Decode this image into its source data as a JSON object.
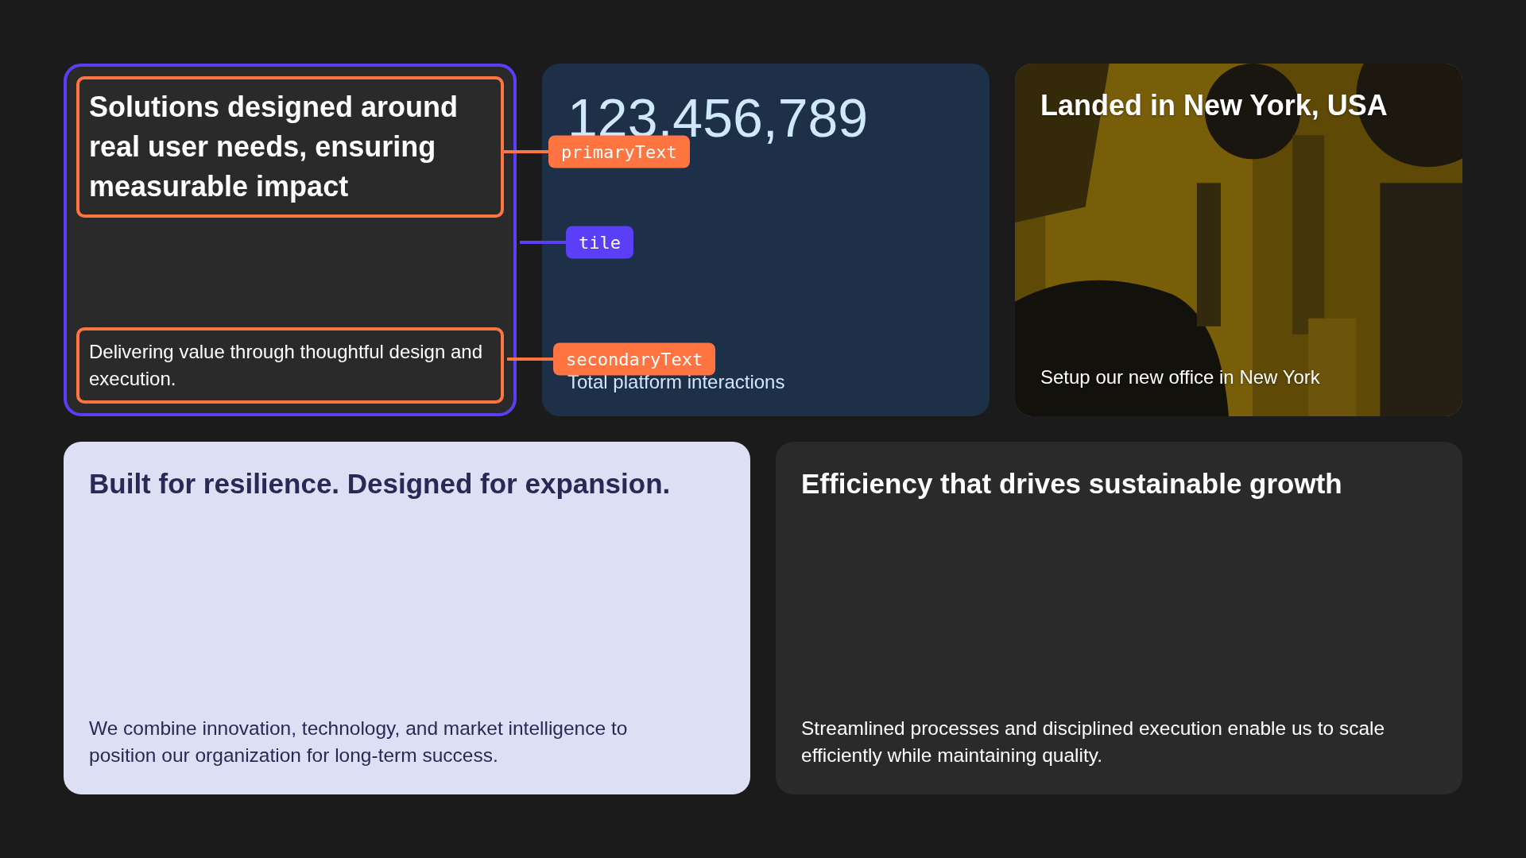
{
  "tiles": [
    {
      "kind": "text",
      "primary": "Solutions designed around real user needs, ensuring measurable impact",
      "secondary": "Delivering value through thoughtful design and execution."
    },
    {
      "kind": "stat",
      "primary": "123,456,789",
      "secondary": "Total platform interactions"
    },
    {
      "primary": "Landed in New York, USA",
      "secondary": "Setup our new office in New York"
    },
    {
      "kind": "accent",
      "primary": "Built for resilience. Designed for expansion.",
      "secondary": "We combine innovation, technology, and market intelligence to position our organization for long-term success."
    },
    {
      "kind": "text",
      "primary": "Efficiency that drives sustainable growth",
      "secondary": "Streamlined processes and disciplined execution enable us to scale efficiently while maintaining quality."
    }
  ],
  "annotations": [
    {
      "label": "primaryText",
      "kind": "primary",
      "color": "#ff7440"
    },
    {
      "label": "tile",
      "kind": "tile",
      "color": "#5b3ff6"
    },
    {
      "label": "secondaryText",
      "kind": "secondary",
      "color": "#ff7440"
    }
  ]
}
